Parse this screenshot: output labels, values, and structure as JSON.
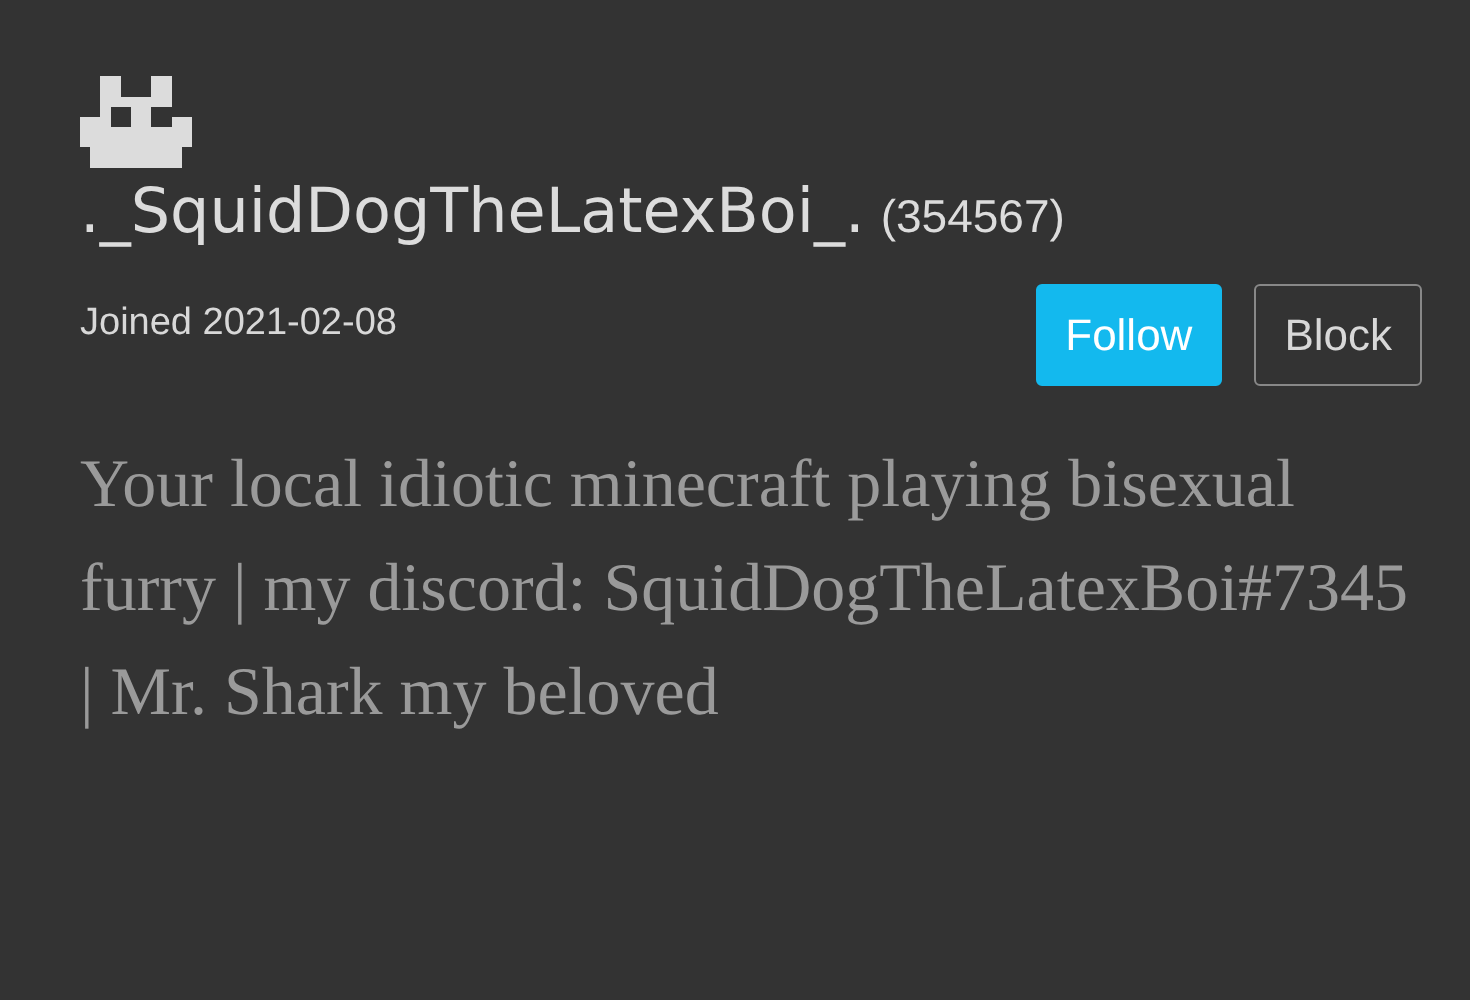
{
  "profile": {
    "username": "._SquidDogTheLatexBoi_.",
    "points": "(354567)",
    "joined": "Joined 2021-02-08",
    "buttons": [
      {
        "kind": "primary",
        "label": "Follow"
      },
      {
        "kind": "outline",
        "label": "Block"
      }
    ],
    "bio": "Your local idiotic minecraft playing bisexual furry | my discord: SquidDogTheLatexBoi#7345 | Mr. Shark my beloved"
  }
}
